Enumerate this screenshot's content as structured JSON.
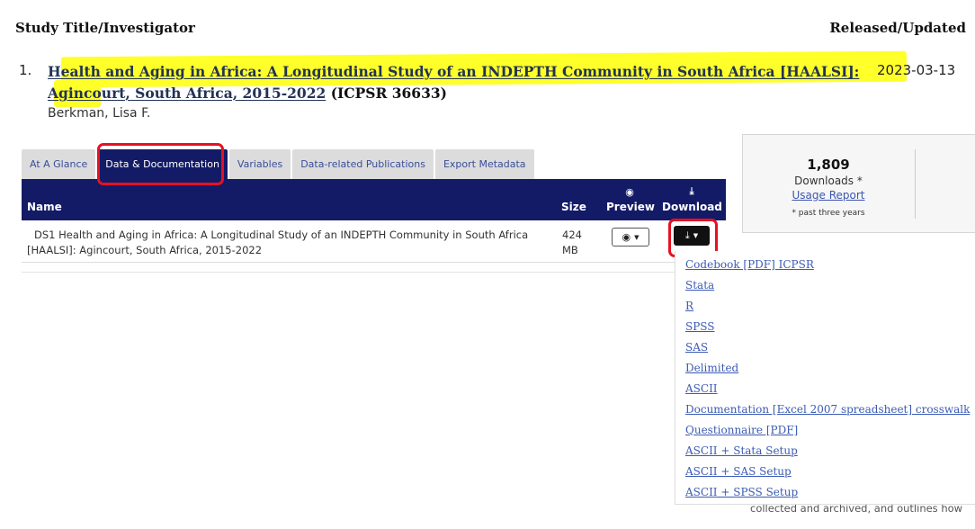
{
  "header": {
    "left_label": "Study Title/Investigator",
    "right_label": "Released/Updated"
  },
  "result": {
    "index": "1.",
    "title_line1": "Health and Aging in Africa: A Longitudinal Study of an INDEPTH Community in South Africa [HAALSI]:",
    "title_line2": "Agincourt, South Africa, 2015-2022",
    "icpsr_label": "(ICPSR 36633)",
    "release_date": "2023-03-13",
    "investigator": "Berkman, Lisa F."
  },
  "tabs": [
    {
      "label": "At A Glance",
      "active": false
    },
    {
      "label": "Data & Documentation",
      "active": true
    },
    {
      "label": "Variables",
      "active": false
    },
    {
      "label": "Data-related Publications",
      "active": false
    },
    {
      "label": "Export Metadata",
      "active": false
    }
  ],
  "table": {
    "columns": {
      "name": "Name",
      "size": "Size",
      "preview": "Preview",
      "download": "Download"
    },
    "row": {
      "name": "DS1 Health and Aging in Africa: A Longitudinal Study of an INDEPTH Community in South Africa [HAALSI]: Agincourt, South Africa, 2015-2022",
      "size_line1": "424",
      "size_line2": "MB"
    }
  },
  "stats": {
    "downloads_count": "1,809",
    "downloads_label": "Downloads *",
    "usage_report_label": "Usage Report",
    "footnote": "* past three years"
  },
  "download_menu": [
    "Codebook [PDF] ICPSR",
    "Stata",
    "R",
    "SPSS",
    "SAS",
    "Delimited",
    "ASCII",
    "Documentation [Excel 2007 spreadsheet] crosswalk",
    "Questionnaire [PDF]",
    "ASCII + Stata Setup",
    "ASCII + SAS Setup",
    "ASCII + SPSS Setup"
  ],
  "background_text": "collected and archived, and outlines how",
  "icons": {
    "preview": "eye-icon",
    "download": "download-icon",
    "dropdown": "caret-down-icon"
  },
  "colors": {
    "highlight": "#ffff2a",
    "annotation_box": "#e51222",
    "table_header": "#141b66",
    "link": "#3b5bb5"
  }
}
